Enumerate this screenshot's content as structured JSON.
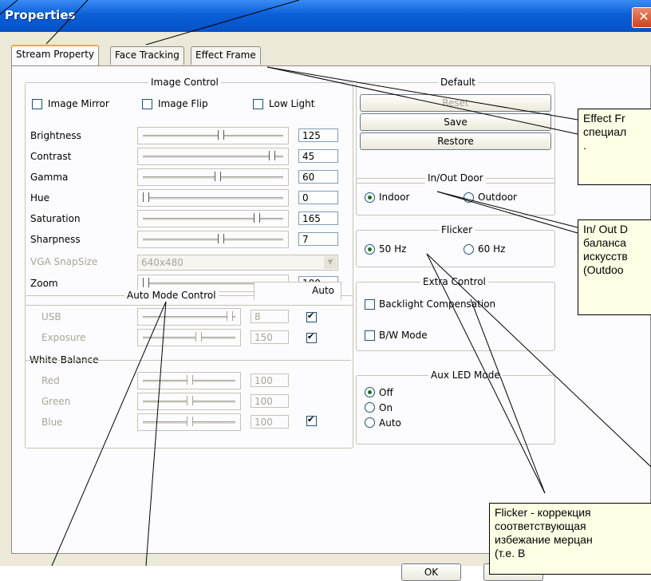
{
  "window": {
    "title": "Properties",
    "close_symbol": "✕"
  },
  "tabs": [
    "Stream Property",
    "Face Tracking",
    "Effect Frame"
  ],
  "image_control": {
    "title": "Image Control",
    "checkboxes": [
      "Image Mirror",
      "Image Flip",
      "Low Light"
    ],
    "rows": [
      {
        "label": "Brightness",
        "value": "125",
        "level": 0.55
      },
      {
        "label": "Contrast",
        "value": "45",
        "level": 0.93
      },
      {
        "label": "Gamma",
        "value": "60",
        "level": 0.53
      },
      {
        "label": "Hue",
        "value": "0",
        "level": 0.0
      },
      {
        "label": "Saturation",
        "value": "165",
        "level": 0.82
      },
      {
        "label": "Sharpness",
        "value": "7",
        "level": 0.55
      }
    ],
    "vga": {
      "label": "VGA SnapSize",
      "value": "640x480"
    },
    "zoom": {
      "label": "Zoom",
      "value": "100",
      "level": 0.0
    }
  },
  "auto_mode": {
    "title": "Auto Mode Control",
    "auto_header": "Auto",
    "rows": [
      {
        "label": "USB",
        "value": "8",
        "level": 0.95,
        "auto": true
      },
      {
        "label": "Exposure",
        "value": "150",
        "level": 0.6,
        "auto": true
      }
    ]
  },
  "white_balance": {
    "title": "White Balance",
    "rows": [
      {
        "label": "Red",
        "value": "100",
        "level": 0.5
      },
      {
        "label": "Green",
        "value": "100",
        "level": 0.5
      },
      {
        "label": "Blue",
        "value": "100",
        "level": 0.5
      }
    ],
    "auto": true
  },
  "default_group": {
    "title": "Default",
    "buttons": [
      "Reset",
      "Save",
      "Restore"
    ]
  },
  "inout_door": {
    "title": "In/Out Door",
    "options": [
      "Indoor",
      "Outdoor"
    ],
    "selected": "Indoor"
  },
  "flicker": {
    "title": "Flicker",
    "options": [
      "50 Hz",
      "60 Hz"
    ],
    "selected": "50 Hz"
  },
  "extra_control": {
    "title": "Extra Control",
    "checkboxes": [
      "Backlight Compensation",
      "B/W Mode"
    ]
  },
  "aux_led": {
    "title": "Aux LED Mode",
    "options": [
      "Off",
      "On",
      "Auto"
    ],
    "selected": "Off"
  },
  "footer": {
    "ok": "OK"
  },
  "callouts": {
    "effect": [
      "Effect Fr",
      "специал",
      "."
    ],
    "inout": [
      "In/ Out D",
      "баланса",
      "искусств",
      "(Outdoo"
    ],
    "flicker": [
      "Flicker - коррекция",
      "соответствующая",
      "избежание мерцан",
      "(т.е. В"
    ]
  }
}
